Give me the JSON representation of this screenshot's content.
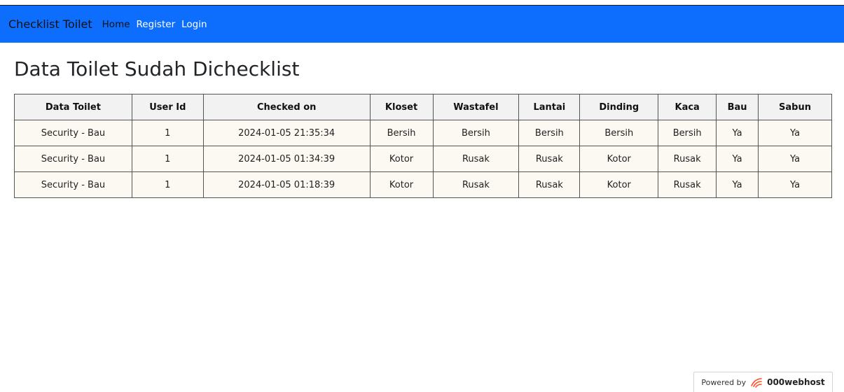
{
  "navbar": {
    "brand": "Checklist Toilet",
    "links": [
      "Home",
      "Register",
      "Login"
    ]
  },
  "page": {
    "title": "Data Toilet Sudah Dichecklist"
  },
  "table": {
    "headers": [
      "Data Toilet",
      "User Id",
      "Checked on",
      "Kloset",
      "Wastafel",
      "Lantai",
      "Dinding",
      "Kaca",
      "Bau",
      "Sabun"
    ],
    "rows": [
      [
        "Security - Bau",
        "1",
        "2024-01-05 21:35:34",
        "Bersih",
        "Bersih",
        "Bersih",
        "Bersih",
        "Bersih",
        "Ya",
        "Ya"
      ],
      [
        "Security - Bau",
        "1",
        "2024-01-05 01:34:39",
        "Kotor",
        "Rusak",
        "Rusak",
        "Kotor",
        "Rusak",
        "Ya",
        "Ya"
      ],
      [
        "Security - Bau",
        "1",
        "2024-01-05 01:18:39",
        "Kotor",
        "Rusak",
        "Rusak",
        "Kotor",
        "Rusak",
        "Ya",
        "Ya"
      ]
    ]
  },
  "footer_badge": {
    "prefix": "Powered by",
    "brand": "000webhost",
    "icon": "000webhost-logo-icon",
    "logo_color": "#ff4b1f"
  },
  "colors": {
    "navbar_bg": "#0d6efd",
    "nav_link": "#ffffff",
    "nav_active": "#111111",
    "header_bg": "#f2f2f2",
    "cell_bg": "#fbf9f2"
  }
}
